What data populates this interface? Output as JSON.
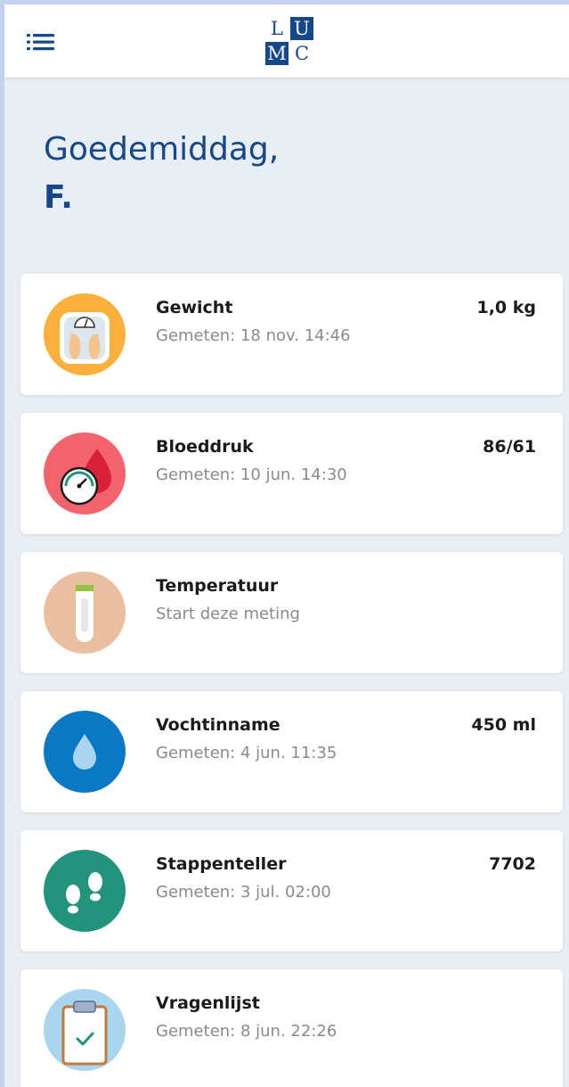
{
  "header": {
    "logo_letters": [
      "L",
      "U",
      "M",
      "C"
    ],
    "menu_icon": "hamburger-list-icon"
  },
  "greeting": {
    "line1": "Goedemiddag,",
    "name": "F."
  },
  "measurements": [
    {
      "title": "Gewicht",
      "subtitle": "Gemeten: 18 nov. 14:46",
      "value": "1,0 kg",
      "icon": "scale-icon",
      "icon_color": "#fbb03b"
    },
    {
      "title": "Bloeddruk",
      "subtitle": "Gemeten: 10 jun. 14:30",
      "value": "86/61",
      "icon": "blood-pressure-icon",
      "icon_color": "#f3636e"
    },
    {
      "title": "Temperatuur",
      "subtitle": "Start deze meting",
      "value": "",
      "icon": "thermometer-icon",
      "icon_color": "#ebbe9f"
    },
    {
      "title": "Vochtinname",
      "subtitle": "Gemeten: 4 jun. 11:35",
      "value": "450 ml",
      "icon": "water-drop-icon",
      "icon_color": "#0b78c5"
    },
    {
      "title": "Stappenteller",
      "subtitle": "Gemeten: 3 jul. 02:00",
      "value": "7702",
      "icon": "footsteps-icon",
      "icon_color": "#22947e"
    },
    {
      "title": "Vragenlijst",
      "subtitle": "Gemeten: 8 jun. 22:26",
      "value": "",
      "icon": "clipboard-icon",
      "icon_color": "#a9d6ee"
    }
  ],
  "colors": {
    "brand": "#15488a",
    "background": "#e9eef4",
    "card": "#ffffff"
  }
}
